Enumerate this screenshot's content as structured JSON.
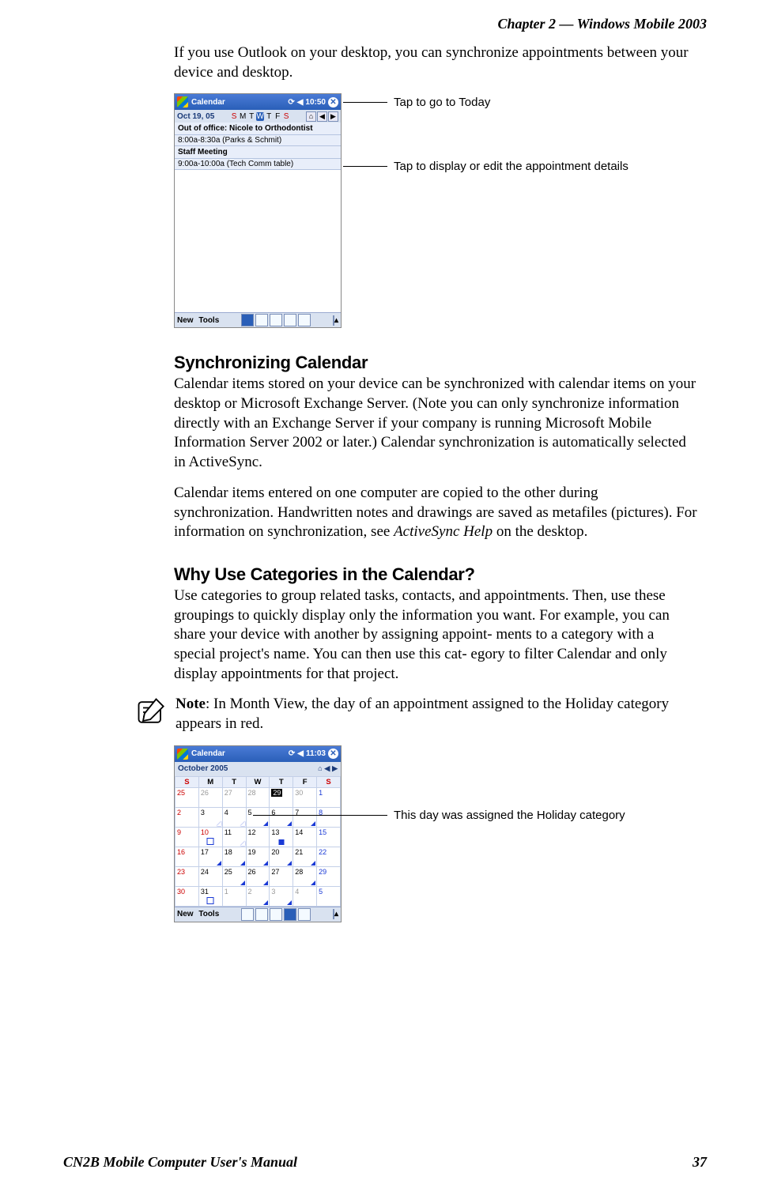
{
  "header": {
    "chapter": "Chapter 2 —  Windows Mobile 2003"
  },
  "intro": "If you use Outlook on your desktop, you can synchronize appointments between your device and desktop.",
  "shot1": {
    "titlebar": {
      "app": "Calendar",
      "time": "10:50",
      "sync": "⟳",
      "vol": "◀",
      "close": "✕"
    },
    "date": "Oct  19, 05",
    "days": [
      "S",
      "M",
      "T",
      "W",
      "T",
      "F",
      "S"
    ],
    "selected_day_index": 3,
    "appt1_title": "Out of office: Nicole to Orthodontist",
    "appt1_sub": "8:00a-8:30a (Parks & Schmit)",
    "appt2_title": "Staff Meeting",
    "appt2_sub": "9:00a-10:00a (Tech Comm table)",
    "bottombar": {
      "new": "New",
      "tools": "Tools"
    },
    "callout1": "Tap to go to Today",
    "callout2": "Tap to display or edit the appointment details"
  },
  "sync_h": "Synchronizing Calendar",
  "sync_p1": "Calendar items stored on your device can be synchronized with calendar items on your desktop or Microsoft Exchange Server. (Note you can only synchronize information directly with an Exchange Server if your company is running Microsoft Mobile Information Server 2002 or later.) Calendar synchronization is automatically selected in ActiveSync.",
  "sync_p2a": "Calendar items entered on one computer are copied to the other during synchronization. Handwritten notes and drawings are saved as metafiles (pictures). For information on synchronization, see ",
  "sync_p2_em": "ActiveSync Help",
  "sync_p2b": " on the desktop.",
  "cat_h": "Why Use Categories in the Calendar?",
  "cat_p": "Use categories to group related tasks, contacts, and appointments. Then, use these groupings to quickly display only the information you want. For example, you can share your device with another by assigning appoint- ments to a category with a special project's name. You can then use this cat- egory to filter Calendar and only display appointments for that project.",
  "note_label": "Note",
  "note_text": ": In Month View, the day of an appointment assigned to the Holiday category appears in red.",
  "shot2": {
    "titlebar": {
      "app": "Calendar",
      "time": "11:03"
    },
    "month": "October 2005",
    "dow": [
      "S",
      "M",
      "T",
      "W",
      "T",
      "F",
      "S"
    ],
    "callout": "This day was assigned the Holiday category",
    "bottombar": {
      "new": "New",
      "tools": "Tools"
    },
    "grid": [
      [
        {
          "n": "25",
          "cls": "red"
        },
        {
          "n": "26",
          "cls": "gray"
        },
        {
          "n": "27",
          "cls": "gray"
        },
        {
          "n": "28",
          "cls": "gray"
        },
        {
          "n": "29",
          "cls": "today"
        },
        {
          "n": "30",
          "cls": "gray"
        },
        {
          "n": "1",
          "cls": "blue"
        }
      ],
      [
        {
          "n": "2",
          "cls": "red"
        },
        {
          "n": "3",
          "mark": "tri-w"
        },
        {
          "n": "4",
          "mark": "tri-w"
        },
        {
          "n": "5",
          "mark": "tri"
        },
        {
          "n": "6",
          "mark": "tri"
        },
        {
          "n": "7",
          "mark": "tri"
        },
        {
          "n": "8",
          "cls": "blue"
        }
      ],
      [
        {
          "n": "9",
          "cls": "red"
        },
        {
          "n": "10",
          "cls": "red",
          "mark": "sq-w"
        },
        {
          "n": "11",
          "mark": "tri-w"
        },
        {
          "n": "12"
        },
        {
          "n": "13",
          "mark": "sq"
        },
        {
          "n": "14"
        },
        {
          "n": "15",
          "cls": "blue"
        }
      ],
      [
        {
          "n": "16",
          "cls": "red"
        },
        {
          "n": "17",
          "mark": "tri"
        },
        {
          "n": "18",
          "mark": "tri"
        },
        {
          "n": "19",
          "mark": "tri"
        },
        {
          "n": "20",
          "mark": "tri"
        },
        {
          "n": "21",
          "mark": "tri"
        },
        {
          "n": "22",
          "cls": "blue"
        }
      ],
      [
        {
          "n": "23",
          "cls": "red"
        },
        {
          "n": "24"
        },
        {
          "n": "25",
          "mark": "tri"
        },
        {
          "n": "26",
          "mark": "tri"
        },
        {
          "n": "27"
        },
        {
          "n": "28",
          "mark": "tri"
        },
        {
          "n": "29",
          "cls": "blue"
        }
      ],
      [
        {
          "n": "30",
          "cls": "red"
        },
        {
          "n": "31",
          "mark": "sq-w"
        },
        {
          "n": "1",
          "cls": "gray"
        },
        {
          "n": "2",
          "cls": "gray",
          "mark": "tri"
        },
        {
          "n": "3",
          "cls": "gray",
          "mark": "tri"
        },
        {
          "n": "4",
          "cls": "gray"
        },
        {
          "n": "5",
          "cls": "blue"
        }
      ]
    ]
  },
  "footer": {
    "left": "CN2B Mobile Computer User's Manual",
    "right": "37"
  }
}
